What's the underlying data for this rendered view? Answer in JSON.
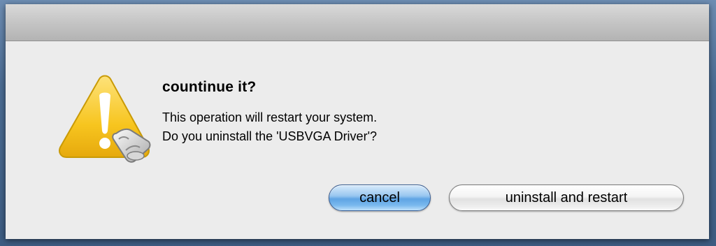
{
  "dialog": {
    "title": "countinue it?",
    "message_lines": [
      "This operation will restart your system.",
      "Do you uninstall the 'USBVGA Driver'?"
    ],
    "icon": "warning-triangle-icon",
    "buttons": {
      "cancel_label": "cancel",
      "confirm_label": "uninstall and restart"
    }
  },
  "colors": {
    "dialog_background": "#ececec",
    "default_button": "#6aaee8",
    "warning_yellow": "#f6c21c"
  }
}
